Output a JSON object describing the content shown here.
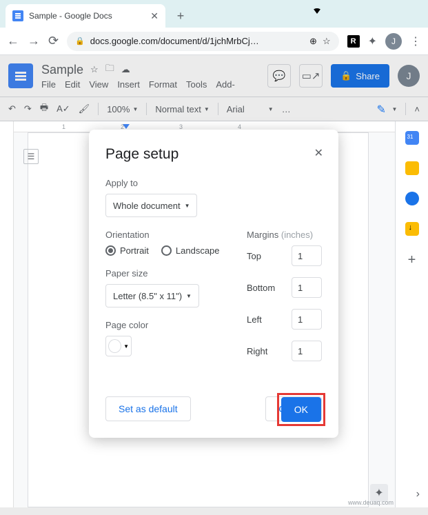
{
  "window": {
    "min": "—",
    "max": "□",
    "close": "✕"
  },
  "browser": {
    "tab_title": "Sample - Google Docs",
    "newtab": "+",
    "back": "←",
    "fwd": "→",
    "reload": "⟳",
    "lock": "🔒",
    "url": "docs.google.com/document/d/1jchMrbCj…",
    "zoom": "⊕",
    "star": "☆",
    "ext_r": "R",
    "puzzle": "✦",
    "avatar": "J",
    "menu": "⋮"
  },
  "docs": {
    "title": "Sample",
    "star": "☆",
    "move": "🗀",
    "cloud": "☁",
    "menu": [
      "File",
      "Edit",
      "View",
      "Insert",
      "Format",
      "Tools",
      "Add-"
    ],
    "comment": "💬",
    "present": "▭↗",
    "share_lock": "🔒",
    "share": "Share",
    "avatar": "J"
  },
  "toolbar": {
    "undo": "↶",
    "redo": "↷",
    "print": "🖶",
    "spell": "A✓",
    "paint": "🖌",
    "zoom": "100%",
    "style": "Normal text",
    "font": "Arial",
    "more": "…",
    "pencaret": "▼",
    "chevup": "˄"
  },
  "ruler": {
    "m1": "1",
    "m2": "2",
    "m3": "3",
    "m4": "4"
  },
  "outline": "☰",
  "side": {
    "plus": "+",
    "chev": "›"
  },
  "explore": "✦",
  "watermark": "www.deuaq.com",
  "dialog": {
    "title": "Page setup",
    "close": "✕",
    "apply_label": "Apply to",
    "apply_value": "Whole document",
    "orientation_label": "Orientation",
    "portrait": "Portrait",
    "landscape": "Landscape",
    "paper_label": "Paper size",
    "paper_value": "Letter (8.5\" x 11\")",
    "color_label": "Page color",
    "margins_label": "Margins ",
    "inches": "(inches)",
    "top": "Top",
    "bottom": "Bottom",
    "left": "Left",
    "right": "Right",
    "v_top": "1",
    "v_bottom": "1",
    "v_left": "1",
    "v_right": "1",
    "default": "Set as default",
    "cancel": "Cancel",
    "ok": "OK",
    "caret": "▼"
  }
}
